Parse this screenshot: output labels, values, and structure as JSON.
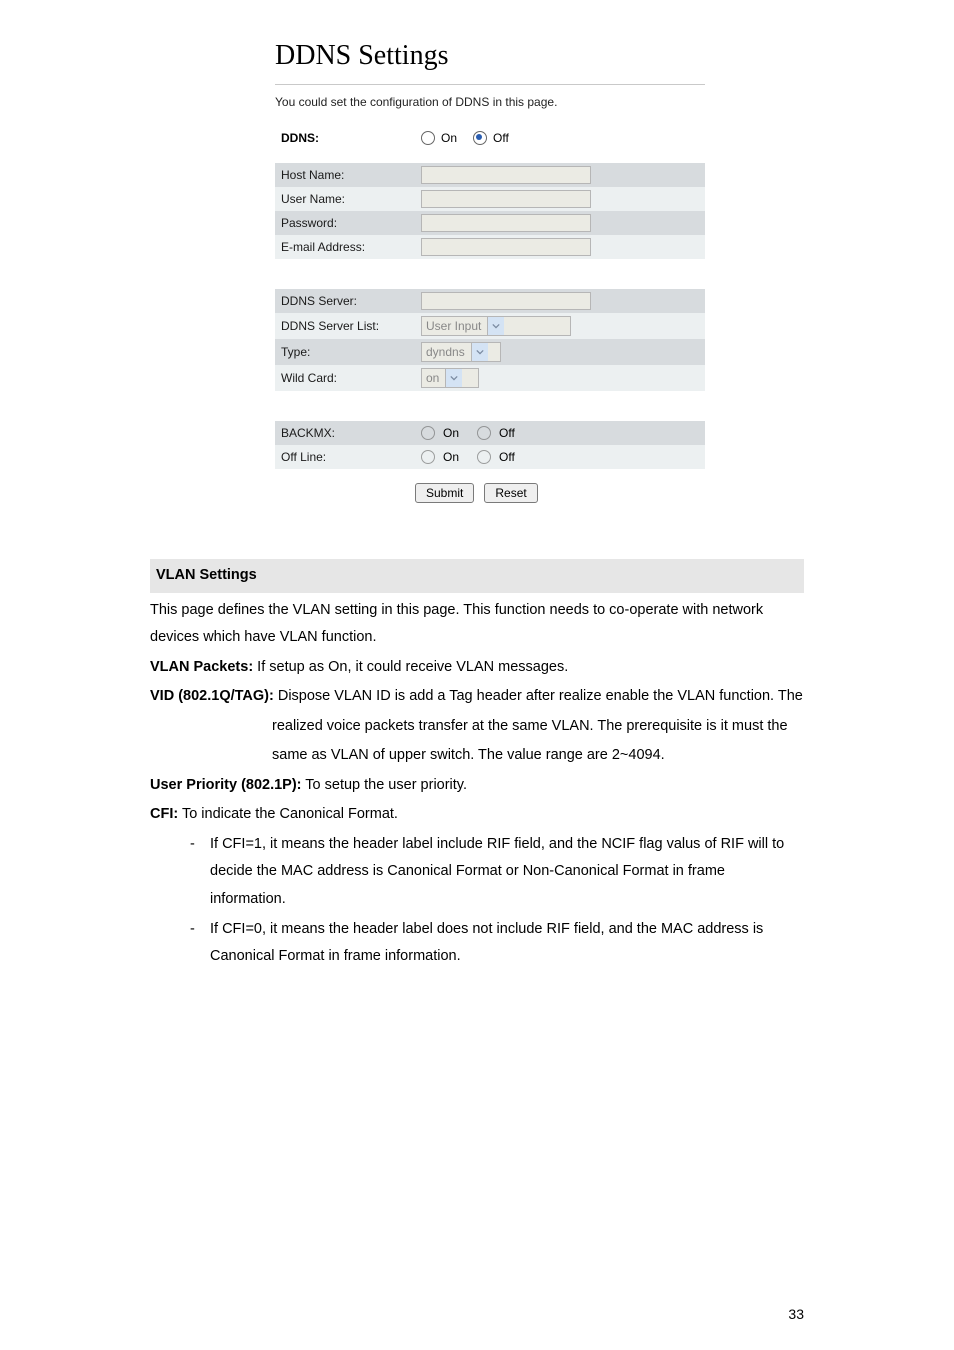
{
  "screenshot": {
    "title": "DDNS Settings",
    "caption": "You could set the configuration of DDNS in this page.",
    "ddns_label": "DDNS:",
    "radio_on": "On",
    "radio_off": "Off",
    "group1": {
      "host_name": "Host Name:",
      "user_name": "User Name:",
      "password": "Password:",
      "email": "E-mail Address:"
    },
    "group2": {
      "ddns_server": "DDNS Server:",
      "ddns_server_list": "DDNS Server List:",
      "ddns_server_list_value": "User Input",
      "type": "Type:",
      "type_value": "dyndns",
      "wild_card": "Wild Card:",
      "wild_card_value": "on"
    },
    "group3": {
      "backmx": "BACKMX:",
      "offline": "Off Line:",
      "opt_on": "On",
      "opt_off": "Off"
    },
    "submit": "Submit",
    "reset": "Reset"
  },
  "doc": {
    "heading": "VLAN Settings",
    "p1": "This page defines the VLAN setting in this page. This function needs to co-operate with network devices which have VLAN function.",
    "vlan_packets_label": "VLAN Packets:",
    "vlan_packets_text": " If setup as On, it could receive VLAN messages.",
    "vid_label": "VID (802.1Q/TAG):",
    "vid_text_line1": " Dispose VLAN ID is add a Tag header after realize enable the VLAN function. The",
    "vid_text_line2": "realized voice packets transfer at the same VLAN. The prerequisite is it must the",
    "vid_text_line3": "same as VLAN of upper switch. The value range are 2~4094.",
    "user_priority_label": "User Priority (802.1P):",
    "user_priority_text": " To setup the user priority.",
    "cfi_label": "CFI:",
    "cfi_text": " To indicate the Canonical Format.",
    "bullet1": "If CFI=1, it means the header label include RIF field, and the NCIF flag valus of RIF will to decide the MAC address is Canonical Format or Non-Canonical Format in frame information.",
    "bullet2": "If CFI=0, it means the header label does not include RIF field, and the MAC address is Canonical Format in frame information.",
    "page_number": "33"
  }
}
